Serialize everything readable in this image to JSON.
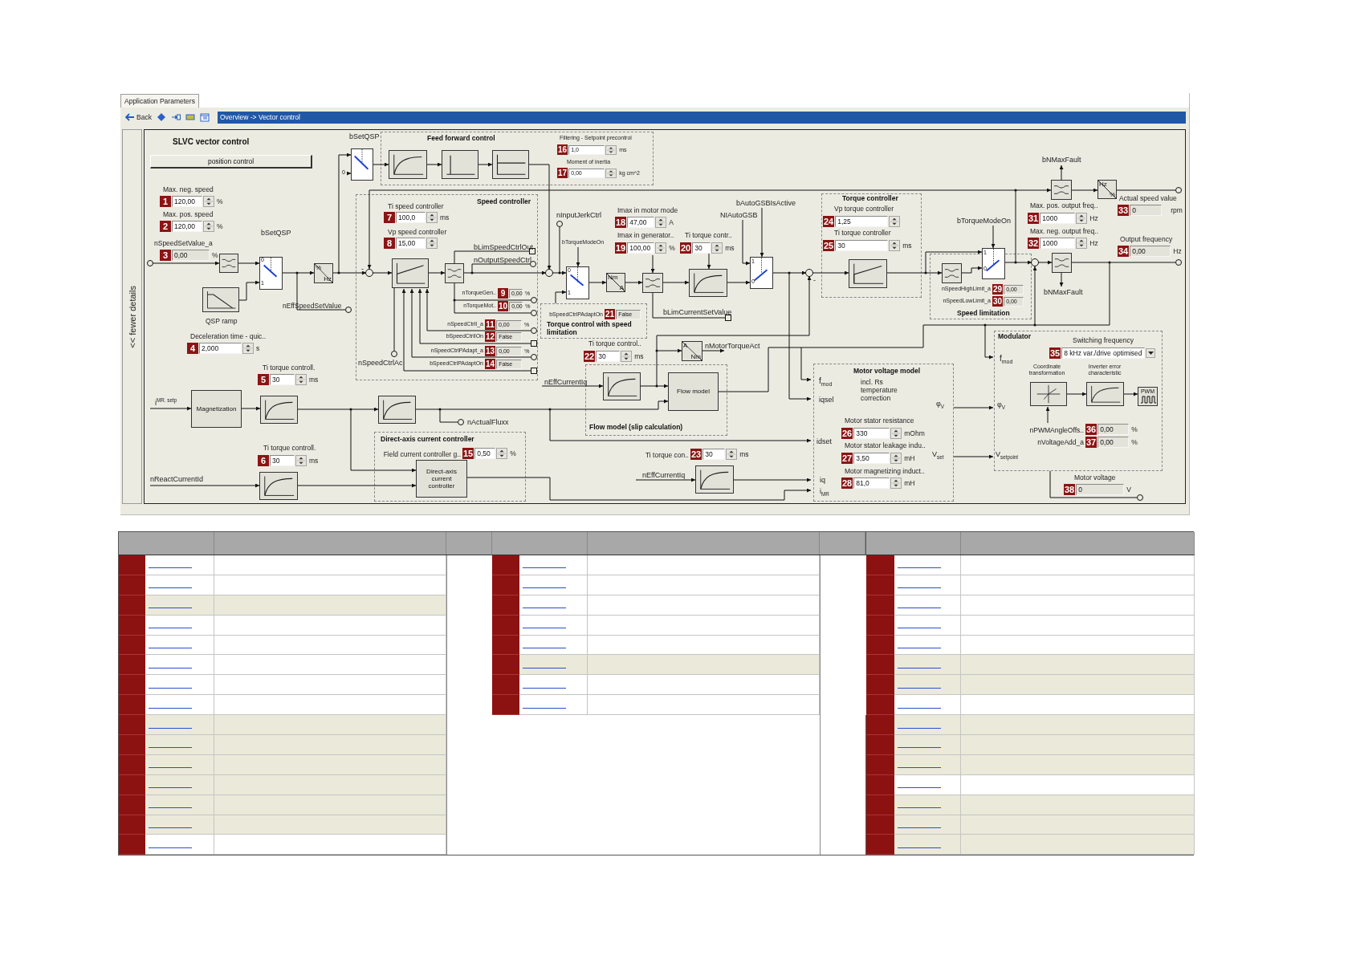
{
  "tab": "Application Parameters",
  "toolbar": {
    "back": "Back",
    "breadcrumb": "Overview -> Vector control"
  },
  "details_toggle": "<< fewer details",
  "diagram": {
    "title": "SLVC vector control",
    "mode_button": "position control",
    "groups": [
      {
        "title": "Feed forward control"
      },
      {
        "title": "Speed controller"
      },
      {
        "title": "Torque controller"
      },
      {
        "title": "Speed limitation"
      },
      {
        "title": "Torque control with speed limitation"
      },
      {
        "title": "Direct-axis current controller"
      },
      {
        "title": "Flow model (slip calculation)"
      },
      {
        "title": "Motor voltage model"
      },
      {
        "title": "Modulator"
      }
    ],
    "parameters": [
      {
        "number": "1",
        "label": "Max. neg. speed",
        "value": "120,00",
        "unit": "%",
        "kind": "spin"
      },
      {
        "number": "2",
        "label": "Max. pos. speed",
        "value": "120,00",
        "unit": "%",
        "kind": "spin"
      },
      {
        "number": "3",
        "label": "nSpeedSetValue_a",
        "value": "0,00",
        "unit": "%",
        "kind": "readout"
      },
      {
        "number": "4",
        "label": "Deceleration time - quic..",
        "value": "2,000",
        "unit": "s",
        "kind": "spin"
      },
      {
        "number": "5",
        "label": "Ti torque controll.",
        "value": "30",
        "unit": "ms",
        "kind": "spin"
      },
      {
        "number": "6",
        "label": "Ti torque controll.",
        "value": "30",
        "unit": "ms",
        "kind": "spin"
      },
      {
        "number": "7",
        "label": "Ti speed controller",
        "value": "100,0",
        "unit": "ms",
        "kind": "spin"
      },
      {
        "number": "8",
        "label": "Vp speed controller",
        "value": "15,00",
        "kind": "spin"
      },
      {
        "number": "9",
        "label": "nTorqueGen..",
        "value": "0,00",
        "unit": "%",
        "kind": "readout"
      },
      {
        "number": "10",
        "label": "nTorqueMot..",
        "value": "0,00",
        "unit": "%",
        "kind": "readout"
      },
      {
        "number": "11",
        "label": "nSpeedCtrlI_a",
        "value": "0,00",
        "unit": "%",
        "kind": "readout"
      },
      {
        "number": "12",
        "label": "bSpeedCtrlIOn",
        "value": "False",
        "kind": "readout"
      },
      {
        "number": "13",
        "label": "nSpeedCtrlPAdapt_a",
        "value": "0,00",
        "unit": "%",
        "kind": "readout"
      },
      {
        "number": "14",
        "label": "bSpeedCtrlPAdaptOn",
        "value": "False",
        "kind": "readout"
      },
      {
        "number": "15",
        "label": "Field current controller g..",
        "value": "0,50",
        "unit": "%",
        "kind": "spin"
      },
      {
        "number": "16",
        "label": "Filtering - Setpoint precontrol",
        "value": "1,0",
        "unit": "ms",
        "kind": "spin"
      },
      {
        "number": "17",
        "label": "Moment of inertia",
        "value": "0,00",
        "unit": "kg cm^2",
        "kind": "spin"
      },
      {
        "number": "18",
        "label": "Imax in motor mode",
        "value": "47,00",
        "unit": "A",
        "kind": "spin"
      },
      {
        "number": "19",
        "label": "Imax in generator..",
        "value": "100,00",
        "unit": "%",
        "kind": "spin"
      },
      {
        "number": "20",
        "label": "Ti torque contr..",
        "value": "30",
        "unit": "ms",
        "kind": "spin"
      },
      {
        "number": "21",
        "label": "bSpeedCtrlPAdaptOn",
        "value": "False",
        "kind": "readout"
      },
      {
        "number": "22",
        "label": "Ti torque control..",
        "value": "30",
        "unit": "ms",
        "kind": "spin"
      },
      {
        "number": "23",
        "label": "Ti torque con..",
        "value": "30",
        "unit": "ms",
        "kind": "spin"
      },
      {
        "number": "24",
        "label": "Vp torque controller",
        "value": "1,25",
        "kind": "spin"
      },
      {
        "number": "25",
        "label": "Ti torque controller",
        "value": "30",
        "unit": "ms",
        "kind": "spin"
      },
      {
        "number": "26",
        "label": "Motor stator resistance",
        "value": "330",
        "unit": "mOhm",
        "kind": "spin"
      },
      {
        "number": "27",
        "label": "Motor stator leakage indu..",
        "value": "3,50",
        "unit": "mH",
        "kind": "spin"
      },
      {
        "number": "28",
        "label": "Motor magnetizing induct..",
        "value": "81,0",
        "unit": "mH",
        "kind": "spin"
      },
      {
        "number": "29",
        "label": "nSpeedHighLimit_a",
        "value": "0,00",
        "kind": "readout"
      },
      {
        "number": "30",
        "label": "nSpeedLowLimit_a",
        "value": "0,00",
        "kind": "readout"
      },
      {
        "number": "31",
        "label": "Max. pos. output freq..",
        "value": "1000",
        "unit": "Hz",
        "kind": "spin"
      },
      {
        "number": "32",
        "label": "Max. neg. output freq..",
        "value": "1000",
        "unit": "Hz",
        "kind": "spin"
      },
      {
        "number": "33",
        "label": "Actual speed value",
        "value": "0",
        "unit": "rpm",
        "kind": "readout"
      },
      {
        "number": "34",
        "label": "Output frequency",
        "value": "0,00",
        "unit": "Hz",
        "kind": "readout"
      },
      {
        "number": "35",
        "label": "Switching frequency",
        "value": "8 kHz var./drive optimised",
        "kind": "dropdown"
      },
      {
        "number": "36",
        "label": "nPWMAngleOffs..",
        "value": "0,00",
        "unit": "%",
        "kind": "readout"
      },
      {
        "number": "37",
        "label": "nVoltageAdd_a",
        "value": "0,00",
        "unit": "%",
        "kind": "readout"
      },
      {
        "number": "38",
        "label": "Motor voltage",
        "value": "0",
        "unit": "V",
        "kind": "readout"
      }
    ],
    "blocks": [
      {
        "kind": "pt1"
      },
      {
        "kind": "pulse"
      },
      {
        "kind": "hold"
      },
      {
        "kind": "limiter"
      },
      {
        "kind": "ramp"
      },
      {
        "kind": "convert",
        "top": "%",
        "bottom": "Hz"
      },
      {
        "kind": "pi"
      },
      {
        "kind": "limiter"
      },
      {
        "kind": "convert",
        "top": "Nm",
        "bottom": "A"
      },
      {
        "kind": "limiter"
      },
      {
        "kind": "pt1"
      },
      {
        "kind": "pi"
      },
      {
        "kind": "limiter"
      },
      {
        "kind": "limiter"
      },
      {
        "kind": "convert",
        "top": "Hz",
        "bottom": "%"
      },
      {
        "kind": "limiter"
      },
      {
        "kind": "text",
        "text": "Magnetization"
      },
      {
        "kind": "pt1"
      },
      {
        "kind": "pt1"
      },
      {
        "kind": "pt1"
      },
      {
        "kind": "text",
        "text": "Direct-axis current controller"
      },
      {
        "kind": "convert",
        "top": "A",
        "bottom": "Nm"
      },
      {
        "kind": "pt1"
      },
      {
        "kind": "text",
        "text": "Flow model"
      },
      {
        "kind": "pt1"
      },
      {
        "kind": "coord"
      },
      {
        "kind": "pt1"
      },
      {
        "kind": "pwm",
        "text": "PWM"
      }
    ],
    "switches": [
      {
        "ports": [
          "0"
        ]
      },
      {
        "ports": [
          "0",
          "1"
        ]
      },
      {
        "ports": [
          "0",
          "1"
        ]
      },
      {
        "ports": [
          "1",
          "0"
        ]
      },
      {
        "ports": [
          "1",
          "0"
        ]
      }
    ],
    "signals": [
      {
        "text": "bSetQSP"
      },
      {
        "text": "bSetQSP"
      },
      {
        "text": "nEffSpeedSetValue"
      },
      {
        "text": "QSP ramp"
      },
      {
        "text": "bLimSpeedCtrlOut"
      },
      {
        "text": "nOutputSpeedCtrl"
      },
      {
        "text": "nSpeedCtrlAc"
      },
      {
        "text": "nInputJerkCtrl"
      },
      {
        "text": "bTorqueModeOn"
      },
      {
        "text": "bAutoGSBIsActive"
      },
      {
        "text": "NIAutoGSB"
      },
      {
        "text": "bLimCurrentSetValue"
      },
      {
        "text": "nMotorTorqueAct"
      },
      {
        "text": "nEffCurrentIq"
      },
      {
        "text": "nActualFluxx"
      },
      {
        "text": "nReactCurrentId"
      },
      {
        "text": "i$^{MR. setp}$"
      },
      {
        "text": "nEffCurrentIq"
      },
      {
        "text": "bTorqueModeOn"
      },
      {
        "text": "bNMaxFault"
      },
      {
        "text": "bNMaxFault"
      },
      {
        "text": "f$_{mod}$"
      },
      {
        "text": "iqsel"
      },
      {
        "text": "idset"
      },
      {
        "text": "iq"
      },
      {
        "text": "i$_{MR}$"
      },
      {
        "text": "φ$_{V}$"
      },
      {
        "text": "V$_{set}$"
      },
      {
        "text": "f$_{mod}$"
      },
      {
        "text": "φ$_{V}$"
      },
      {
        "text": "V$_{setpoint}$"
      },
      {
        "text": "incl. Rs temperature correction"
      },
      {
        "text": "Coordinate transformation"
      },
      {
        "text": "Inverter error characteristic"
      },
      {
        "text": "-"
      },
      {
        "text": "-"
      }
    ]
  },
  "table": {
    "groups": [
      {
        "rows": [
          {
            "highlighted": false
          },
          {
            "highlighted": false
          },
          {
            "highlighted": true
          },
          {
            "highlighted": false
          },
          {
            "highlighted": false
          },
          {
            "highlighted": false
          },
          {
            "highlighted": false
          },
          {
            "highlighted": false
          },
          {
            "highlighted": true
          },
          {
            "highlighted": true
          },
          {
            "highlighted": true
          },
          {
            "highlighted": true
          },
          {
            "highlighted": true
          },
          {
            "highlighted": true
          },
          {
            "highlighted": false
          }
        ]
      },
      {
        "rows": [
          {
            "highlighted": false
          },
          {
            "highlighted": false
          },
          {
            "highlighted": false
          },
          {
            "highlighted": false
          },
          {
            "highlighted": false
          },
          {
            "highlighted": true
          },
          {
            "highlighted": false
          },
          {
            "highlighted": false
          }
        ]
      },
      {
        "rows": [
          {
            "highlighted": false
          },
          {
            "highlighted": false
          },
          {
            "highlighted": false
          },
          {
            "highlighted": false
          },
          {
            "highlighted": false
          },
          {
            "highlighted": true
          },
          {
            "highlighted": true
          },
          {
            "highlighted": false
          },
          {
            "highlighted": true
          },
          {
            "highlighted": true
          },
          {
            "highlighted": true
          },
          {
            "highlighted": false
          },
          {
            "highlighted": true
          },
          {
            "highlighted": true
          },
          {
            "highlighted": true
          }
        ]
      }
    ]
  }
}
